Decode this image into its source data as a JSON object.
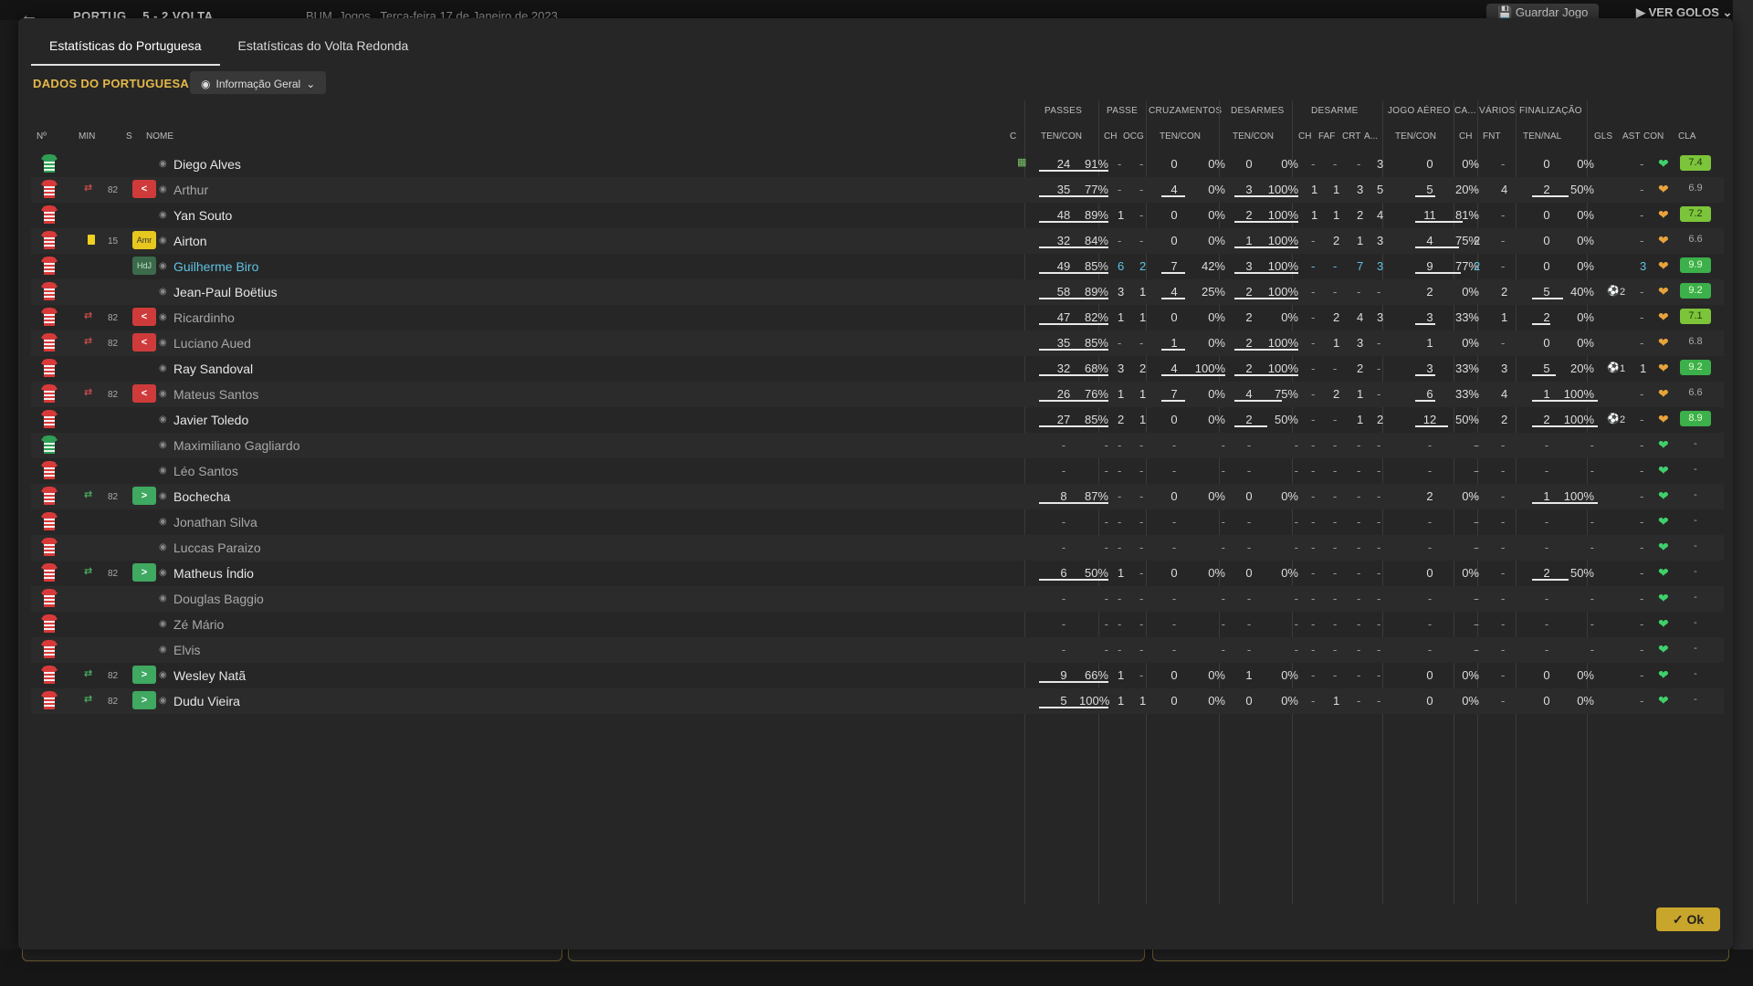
{
  "app": {
    "back_icon": "back-arrow-icon",
    "match_title": "PORTUG… 5 - 2 VOLTA",
    "venue": "BUM, Jogos",
    "date": "Terça-feira 17 de Janeiro de 2023",
    "save_label": "Guardar Jogo",
    "goals_label": "VER GOLOS"
  },
  "tabs": [
    {
      "label": "Estatísticas do Portuguesa",
      "active": true
    },
    {
      "label": "Estatísticas do Volta Redonda",
      "active": false
    }
  ],
  "section_title": "DADOS DO PORTUGUESA",
  "view_select": {
    "label": "Informação Geral"
  },
  "columns": {
    "groups": [
      "PASSES",
      "PASSE",
      "CRUZAMENTOS",
      "DESARMES",
      "DESARME",
      "JOGO AÉREO",
      "CA...",
      "VÁRIOS",
      "FINALIZAÇÃO"
    ],
    "headers": [
      "Nº",
      "MIN",
      "S",
      "NOME",
      "C",
      "TEN/CON",
      "CH",
      "OCG",
      "TEN/CON",
      "TEN/CON",
      "CH",
      "FAF",
      "CRT",
      "A...",
      "TEN/CON",
      "CH",
      "FNT",
      "TEN/NAL",
      "GLS",
      "AST",
      "CON",
      "CLA"
    ]
  },
  "players": [
    {
      "name": "Diego Alves",
      "gk": true,
      "min": "",
      "badge": "",
      "sub": "",
      "style": "",
      "captain": true,
      "pass": [
        "24",
        "91%"
      ],
      "ch": "-",
      "ocg": "-",
      "cruz": [
        "0",
        "0%"
      ],
      "des": [
        "0",
        "0%"
      ],
      "ds": [
        "-",
        "-",
        "-",
        "3"
      ],
      "aer": [
        "0",
        "0%"
      ],
      "ca": "-",
      "fnt": "-",
      "fin": [
        "0",
        "0%"
      ],
      "gls": "",
      "ast": "-",
      "heart": "green",
      "cla": "7.4",
      "cla_style": "r-lime"
    },
    {
      "name": "Arthur",
      "gk": false,
      "min": "82",
      "badge": "<",
      "badge_style": "b-red",
      "sub": "out",
      "style": "sub",
      "pass": [
        "35",
        "77%"
      ],
      "ch": "-",
      "ocg": "-",
      "cruz": [
        "4",
        "0%"
      ],
      "des": [
        "3",
        "100%"
      ],
      "ds": [
        "1",
        "1",
        "3",
        "5"
      ],
      "aer": [
        "5",
        "20%"
      ],
      "ca": "-",
      "fnt": "4",
      "fin": [
        "2",
        "50%"
      ],
      "gls": "",
      "ast": "-",
      "heart": "orange",
      "cla": "6.9",
      "cla_style": "r-none"
    },
    {
      "name": "Yan Souto",
      "gk": false,
      "min": "",
      "badge": "",
      "sub": "",
      "style": "",
      "pass": [
        "48",
        "89%"
      ],
      "ch": "1",
      "ocg": "-",
      "cruz": [
        "0",
        "0%"
      ],
      "des": [
        "2",
        "100%"
      ],
      "ds": [
        "1",
        "1",
        "2",
        "4"
      ],
      "aer": [
        "11",
        "81%"
      ],
      "ca": "-",
      "fnt": "-",
      "fin": [
        "0",
        "0%"
      ],
      "gls": "",
      "ast": "-",
      "heart": "orange",
      "cla": "7.2",
      "cla_style": "r-lime"
    },
    {
      "name": "Airton",
      "gk": false,
      "min": "15",
      "badge": "Amr",
      "badge_style": "b-yel",
      "sub": "card",
      "style": "",
      "pass": [
        "32",
        "84%"
      ],
      "ch": "-",
      "ocg": "-",
      "cruz": [
        "0",
        "0%"
      ],
      "des": [
        "1",
        "100%"
      ],
      "ds": [
        "-",
        "2",
        "1",
        "3"
      ],
      "aer": [
        "4",
        "75%"
      ],
      "ca": "2",
      "fnt": "-",
      "fin": [
        "0",
        "0%"
      ],
      "gls": "",
      "ast": "-",
      "heart": "orange",
      "cla": "6.6",
      "cla_style": "r-none"
    },
    {
      "name": "Guilherme Biro",
      "gk": false,
      "min": "",
      "badge": "HdJ",
      "badge_style": "b-hdj",
      "sub": "",
      "style": "hl",
      "pass": [
        "49",
        "85%"
      ],
      "ch": "6",
      "ocg": "2",
      "cruz": [
        "7",
        "42%"
      ],
      "des": [
        "3",
        "100%"
      ],
      "ds": [
        "-",
        "-",
        "7",
        "3"
      ],
      "aer": [
        "9",
        "77%"
      ],
      "ca": "2",
      "fnt": "-",
      "fin": [
        "0",
        "0%"
      ],
      "gls": "",
      "ast": "3",
      "heart": "orange",
      "cla": "9.9",
      "cla_style": "r-green"
    },
    {
      "name": "Jean-Paul Boëtius",
      "gk": false,
      "min": "",
      "badge": "",
      "sub": "",
      "style": "",
      "pass": [
        "58",
        "89%"
      ],
      "ch": "3",
      "ocg": "1",
      "cruz": [
        "4",
        "25%"
      ],
      "des": [
        "2",
        "100%"
      ],
      "ds": [
        "-",
        "-",
        "-",
        "-"
      ],
      "aer": [
        "2",
        "0%"
      ],
      "ca": "-",
      "fnt": "2",
      "fin": [
        "5",
        "40%"
      ],
      "gls": "2",
      "ast": "-",
      "heart": "orange",
      "cla": "9.2",
      "cla_style": "r-green"
    },
    {
      "name": "Ricardinho",
      "gk": false,
      "min": "82",
      "badge": "<",
      "badge_style": "b-red",
      "sub": "out",
      "style": "sub",
      "pass": [
        "47",
        "82%"
      ],
      "ch": "1",
      "ocg": "1",
      "cruz": [
        "0",
        "0%"
      ],
      "des": [
        "2",
        "0%"
      ],
      "ds": [
        "-",
        "2",
        "4",
        "3"
      ],
      "aer": [
        "3",
        "33%"
      ],
      "ca": "-",
      "fnt": "1",
      "fin": [
        "2",
        "0%"
      ],
      "gls": "",
      "ast": "-",
      "heart": "orange",
      "cla": "7.1",
      "cla_style": "r-lime"
    },
    {
      "name": "Luciano Aued",
      "gk": false,
      "min": "82",
      "badge": "<",
      "badge_style": "b-red",
      "sub": "out",
      "style": "sub",
      "pass": [
        "35",
        "85%"
      ],
      "ch": "-",
      "ocg": "-",
      "cruz": [
        "1",
        "0%"
      ],
      "des": [
        "2",
        "100%"
      ],
      "ds": [
        "-",
        "1",
        "3",
        "-"
      ],
      "aer": [
        "1",
        "0%"
      ],
      "ca": "-",
      "fnt": "-",
      "fin": [
        "0",
        "0%"
      ],
      "gls": "",
      "ast": "-",
      "heart": "orange",
      "cla": "6.8",
      "cla_style": "r-none"
    },
    {
      "name": "Ray Sandoval",
      "gk": false,
      "min": "",
      "badge": "",
      "sub": "",
      "style": "",
      "pass": [
        "32",
        "68%"
      ],
      "ch": "3",
      "ocg": "2",
      "cruz": [
        "4",
        "100%"
      ],
      "des": [
        "2",
        "100%"
      ],
      "ds": [
        "-",
        "-",
        "2",
        "-"
      ],
      "aer": [
        "3",
        "33%"
      ],
      "ca": "-",
      "fnt": "3",
      "fin": [
        "5",
        "20%"
      ],
      "gls": "1",
      "ast": "1",
      "heart": "orange",
      "cla": "9.2",
      "cla_style": "r-green"
    },
    {
      "name": "Mateus Santos",
      "gk": false,
      "min": "82",
      "badge": "<",
      "badge_style": "b-red",
      "sub": "out",
      "style": "sub",
      "pass": [
        "26",
        "76%"
      ],
      "ch": "1",
      "ocg": "1",
      "cruz": [
        "7",
        "0%"
      ],
      "des": [
        "4",
        "75%"
      ],
      "ds": [
        "-",
        "2",
        "1",
        "-"
      ],
      "aer": [
        "6",
        "33%"
      ],
      "ca": "-",
      "fnt": "4",
      "fin": [
        "1",
        "100%"
      ],
      "gls": "",
      "ast": "-",
      "heart": "orange",
      "cla": "6.6",
      "cla_style": "r-none"
    },
    {
      "name": "Javier Toledo",
      "gk": false,
      "min": "",
      "badge": "",
      "sub": "",
      "style": "",
      "pass": [
        "27",
        "85%"
      ],
      "ch": "2",
      "ocg": "1",
      "cruz": [
        "0",
        "0%"
      ],
      "des": [
        "2",
        "50%"
      ],
      "ds": [
        "-",
        "-",
        "1",
        "2"
      ],
      "aer": [
        "12",
        "50%"
      ],
      "ca": "-",
      "fnt": "2",
      "fin": [
        "2",
        "100%"
      ],
      "gls": "2",
      "ast": "-",
      "heart": "orange",
      "cla": "8.9",
      "cla_style": "r-green"
    },
    {
      "name": "Maximiliano Gagliardo",
      "gk": true,
      "min": "",
      "badge": "",
      "sub": "",
      "style": "sub",
      "pass": [
        "-",
        "-"
      ],
      "ch": "-",
      "ocg": "-",
      "cruz": [
        "-",
        "-"
      ],
      "des": [
        "-",
        "-"
      ],
      "ds": [
        "-",
        "-",
        "-",
        "-"
      ],
      "aer": [
        "-",
        "-"
      ],
      "ca": "-",
      "fnt": "-",
      "fin": [
        "-",
        "-"
      ],
      "gls": "",
      "ast": "-",
      "heart": "green",
      "cla": "-",
      "cla_style": "r-none"
    },
    {
      "name": "Léo Santos",
      "gk": false,
      "min": "",
      "badge": "",
      "sub": "",
      "style": "sub",
      "pass": [
        "-",
        "-"
      ],
      "ch": "-",
      "ocg": "-",
      "cruz": [
        "-",
        "-"
      ],
      "des": [
        "-",
        "-"
      ],
      "ds": [
        "-",
        "-",
        "-",
        "-"
      ],
      "aer": [
        "-",
        "-"
      ],
      "ca": "-",
      "fnt": "-",
      "fin": [
        "-",
        "-"
      ],
      "gls": "",
      "ast": "-",
      "heart": "green",
      "cla": "-",
      "cla_style": "r-none"
    },
    {
      "name": "Bochecha",
      "gk": false,
      "min": "82",
      "badge": ">",
      "badge_style": "b-green",
      "sub": "in",
      "style": "",
      "pass": [
        "8",
        "87%"
      ],
      "ch": "-",
      "ocg": "-",
      "cruz": [
        "0",
        "0%"
      ],
      "des": [
        "0",
        "0%"
      ],
      "ds": [
        "-",
        "-",
        "-",
        "-"
      ],
      "aer": [
        "2",
        "0%"
      ],
      "ca": "-",
      "fnt": "-",
      "fin": [
        "1",
        "100%"
      ],
      "gls": "",
      "ast": "-",
      "heart": "green",
      "cla": "-",
      "cla_style": "r-none"
    },
    {
      "name": "Jonathan Silva",
      "gk": false,
      "min": "",
      "badge": "",
      "sub": "",
      "style": "sub",
      "pass": [
        "-",
        "-"
      ],
      "ch": "-",
      "ocg": "-",
      "cruz": [
        "-",
        "-"
      ],
      "des": [
        "-",
        "-"
      ],
      "ds": [
        "-",
        "-",
        "-",
        "-"
      ],
      "aer": [
        "-",
        "-"
      ],
      "ca": "-",
      "fnt": "-",
      "fin": [
        "-",
        "-"
      ],
      "gls": "",
      "ast": "-",
      "heart": "green",
      "cla": "-",
      "cla_style": "r-none"
    },
    {
      "name": "Luccas Paraizo",
      "gk": false,
      "min": "",
      "badge": "",
      "sub": "",
      "style": "sub",
      "pass": [
        "-",
        "-"
      ],
      "ch": "-",
      "ocg": "-",
      "cruz": [
        "-",
        "-"
      ],
      "des": [
        "-",
        "-"
      ],
      "ds": [
        "-",
        "-",
        "-",
        "-"
      ],
      "aer": [
        "-",
        "-"
      ],
      "ca": "-",
      "fnt": "-",
      "fin": [
        "-",
        "-"
      ],
      "gls": "",
      "ast": "-",
      "heart": "green",
      "cla": "-",
      "cla_style": "r-none"
    },
    {
      "name": "Matheus Índio",
      "gk": false,
      "min": "82",
      "badge": ">",
      "badge_style": "b-green",
      "sub": "in",
      "style": "",
      "pass": [
        "6",
        "50%"
      ],
      "ch": "1",
      "ocg": "-",
      "cruz": [
        "0",
        "0%"
      ],
      "des": [
        "0",
        "0%"
      ],
      "ds": [
        "-",
        "-",
        "-",
        "-"
      ],
      "aer": [
        "0",
        "0%"
      ],
      "ca": "-",
      "fnt": "-",
      "fin": [
        "2",
        "50%"
      ],
      "gls": "",
      "ast": "-",
      "heart": "green",
      "cla": "-",
      "cla_style": "r-none"
    },
    {
      "name": "Douglas Baggio",
      "gk": false,
      "min": "",
      "badge": "",
      "sub": "",
      "style": "sub",
      "pass": [
        "-",
        "-"
      ],
      "ch": "-",
      "ocg": "-",
      "cruz": [
        "-",
        "-"
      ],
      "des": [
        "-",
        "-"
      ],
      "ds": [
        "-",
        "-",
        "-",
        "-"
      ],
      "aer": [
        "-",
        "-"
      ],
      "ca": "-",
      "fnt": "-",
      "fin": [
        "-",
        "-"
      ],
      "gls": "",
      "ast": "-",
      "heart": "green",
      "cla": "-",
      "cla_style": "r-none"
    },
    {
      "name": "Zé Mário",
      "gk": false,
      "min": "",
      "badge": "",
      "sub": "",
      "style": "sub",
      "pass": [
        "-",
        "-"
      ],
      "ch": "-",
      "ocg": "-",
      "cruz": [
        "-",
        "-"
      ],
      "des": [
        "-",
        "-"
      ],
      "ds": [
        "-",
        "-",
        "-",
        "-"
      ],
      "aer": [
        "-",
        "-"
      ],
      "ca": "-",
      "fnt": "-",
      "fin": [
        "-",
        "-"
      ],
      "gls": "",
      "ast": "-",
      "heart": "green",
      "cla": "-",
      "cla_style": "r-none"
    },
    {
      "name": "Elvis",
      "gk": false,
      "min": "",
      "badge": "",
      "sub": "",
      "style": "sub",
      "pass": [
        "-",
        "-"
      ],
      "ch": "-",
      "ocg": "-",
      "cruz": [
        "-",
        "-"
      ],
      "des": [
        "-",
        "-"
      ],
      "ds": [
        "-",
        "-",
        "-",
        "-"
      ],
      "aer": [
        "-",
        "-"
      ],
      "ca": "-",
      "fnt": "-",
      "fin": [
        "-",
        "-"
      ],
      "gls": "",
      "ast": "-",
      "heart": "green",
      "cla": "-",
      "cla_style": "r-none"
    },
    {
      "name": "Wesley Natã",
      "gk": false,
      "min": "82",
      "badge": ">",
      "badge_style": "b-green",
      "sub": "in",
      "style": "",
      "pass": [
        "9",
        "66%"
      ],
      "ch": "1",
      "ocg": "-",
      "cruz": [
        "0",
        "0%"
      ],
      "des": [
        "1",
        "0%"
      ],
      "ds": [
        "-",
        "-",
        "-",
        "-"
      ],
      "aer": [
        "0",
        "0%"
      ],
      "ca": "-",
      "fnt": "-",
      "fin": [
        "0",
        "0%"
      ],
      "gls": "",
      "ast": "-",
      "heart": "green",
      "cla": "-",
      "cla_style": "r-none"
    },
    {
      "name": "Dudu Vieira",
      "gk": false,
      "min": "82",
      "badge": ">",
      "badge_style": "b-green",
      "sub": "in",
      "style": "",
      "pass": [
        "5",
        "100%"
      ],
      "ch": "1",
      "ocg": "1",
      "cruz": [
        "0",
        "0%"
      ],
      "des": [
        "0",
        "0%"
      ],
      "ds": [
        "-",
        "1",
        "-",
        "-"
      ],
      "aer": [
        "0",
        "0%"
      ],
      "ca": "-",
      "fnt": "-",
      "fin": [
        "0",
        "0%"
      ],
      "gls": "",
      "ast": "-",
      "heart": "green",
      "cla": "-",
      "cla_style": "r-none"
    }
  ],
  "colors": {
    "accent": "#e5b94a",
    "ok": "#c8a52b",
    "heart_green": "#3fd06b",
    "heart_orange": "#e8a33c"
  },
  "ok_label": "Ok"
}
